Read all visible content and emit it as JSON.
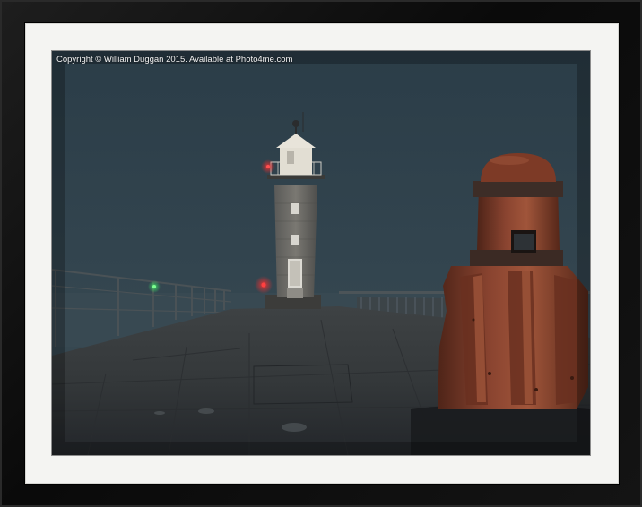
{
  "watermark": {
    "text": "Copyright © William Duggan 2015. Available at Photo4me.com"
  },
  "colors": {
    "frame": "#0d0d0d",
    "mat": "#f4f4f2",
    "fog_sky": "#30414c",
    "harbour_light_red": "#ff2e2e",
    "harbour_light_green": "#3dff6a",
    "bollard_rust": "#7a3a26"
  }
}
